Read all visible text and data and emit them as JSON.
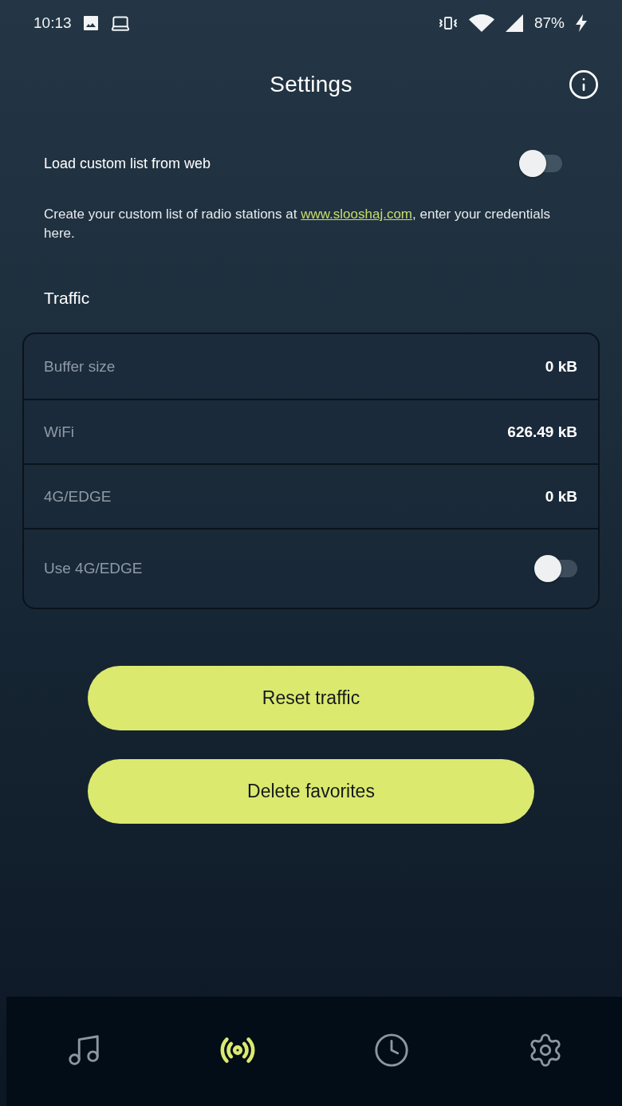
{
  "status_bar": {
    "time": "10:13",
    "battery": "87%"
  },
  "header": {
    "title": "Settings"
  },
  "web_list": {
    "label": "Load custom list from web",
    "on": false,
    "description_before": "Create your custom list of radio stations at ",
    "link": "www.slooshaj.com",
    "description_after": ", enter your credentials here."
  },
  "traffic": {
    "heading": "Traffic",
    "rows": [
      {
        "kind": "value",
        "label": "Buffer size",
        "value": "0 kB"
      },
      {
        "kind": "value",
        "label": "WiFi",
        "value": "626.49 kB"
      },
      {
        "kind": "value",
        "label": "4G/EDGE",
        "value": "0 kB"
      },
      {
        "kind": "toggle",
        "label": "Use 4G/EDGE",
        "on": false
      }
    ]
  },
  "buttons": [
    "Reset traffic",
    "Delete favorites"
  ],
  "nav_tabs": [
    {
      "selected": false
    },
    {
      "selected": true
    },
    {
      "selected": false
    },
    {
      "selected": false
    }
  ]
}
